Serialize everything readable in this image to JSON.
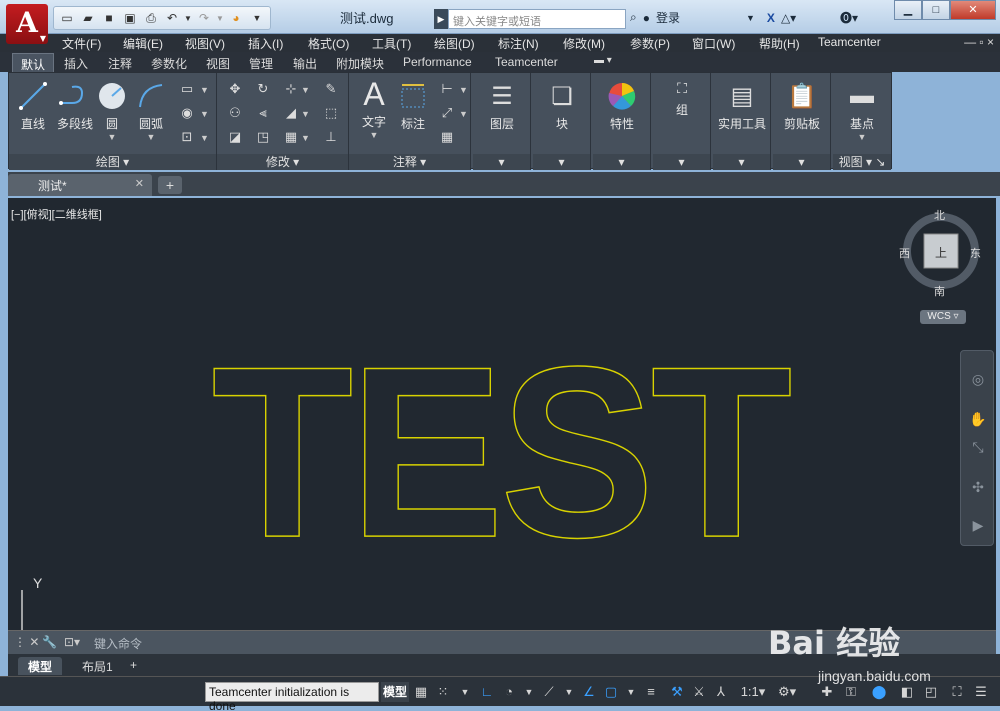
{
  "app": {
    "logo_letter": "A",
    "doc_title": "测试.dwg",
    "search_placeholder": "键入关键字或短语",
    "login_label": "登录"
  },
  "menu": [
    "文件(F)",
    "编辑(E)",
    "视图(V)",
    "插入(I)",
    "格式(O)",
    "工具(T)",
    "绘图(D)",
    "标注(N)",
    "修改(M)",
    "参数(P)",
    "窗口(W)",
    "帮助(H)",
    "Teamcenter"
  ],
  "ribbon_tabs": [
    "默认",
    "插入",
    "注释",
    "参数化",
    "视图",
    "管理",
    "输出",
    "附加模块",
    "Performance",
    "Teamcenter"
  ],
  "ribbon": {
    "draw": {
      "title": "绘图",
      "line": "直线",
      "polyline": "多段线",
      "circle": "圆",
      "arc": "圆弧"
    },
    "modify": {
      "title": "修改"
    },
    "annotation": {
      "title": "注释",
      "text": "文字",
      "dimension": "标注"
    },
    "layers": "图层",
    "block": "块",
    "properties": "特性",
    "groups": "组",
    "utilities": "实用工具",
    "clipboard": "剪贴板",
    "view": {
      "title": "视图",
      "basepoint": "基点"
    }
  },
  "doc_tab": {
    "name": "测试*"
  },
  "viewport": {
    "label": "[−][俯视][二维线框]",
    "drawing_text": "TEST",
    "stroke_color": "#d8d200"
  },
  "viewcube": {
    "north": "北",
    "south": "南",
    "east": "东",
    "west": "西",
    "top": "上",
    "wcs": "WCS"
  },
  "ucs": {
    "y_label": "Y"
  },
  "command": {
    "placeholder": "键入命令"
  },
  "layout_tabs": [
    "模型",
    "布局1"
  ],
  "status": {
    "message": "Teamcenter initialization is done",
    "model": "模型",
    "scale": "1:1"
  },
  "watermark": {
    "name": "Bai  经验",
    "url": "jingyan.baidu.com"
  }
}
